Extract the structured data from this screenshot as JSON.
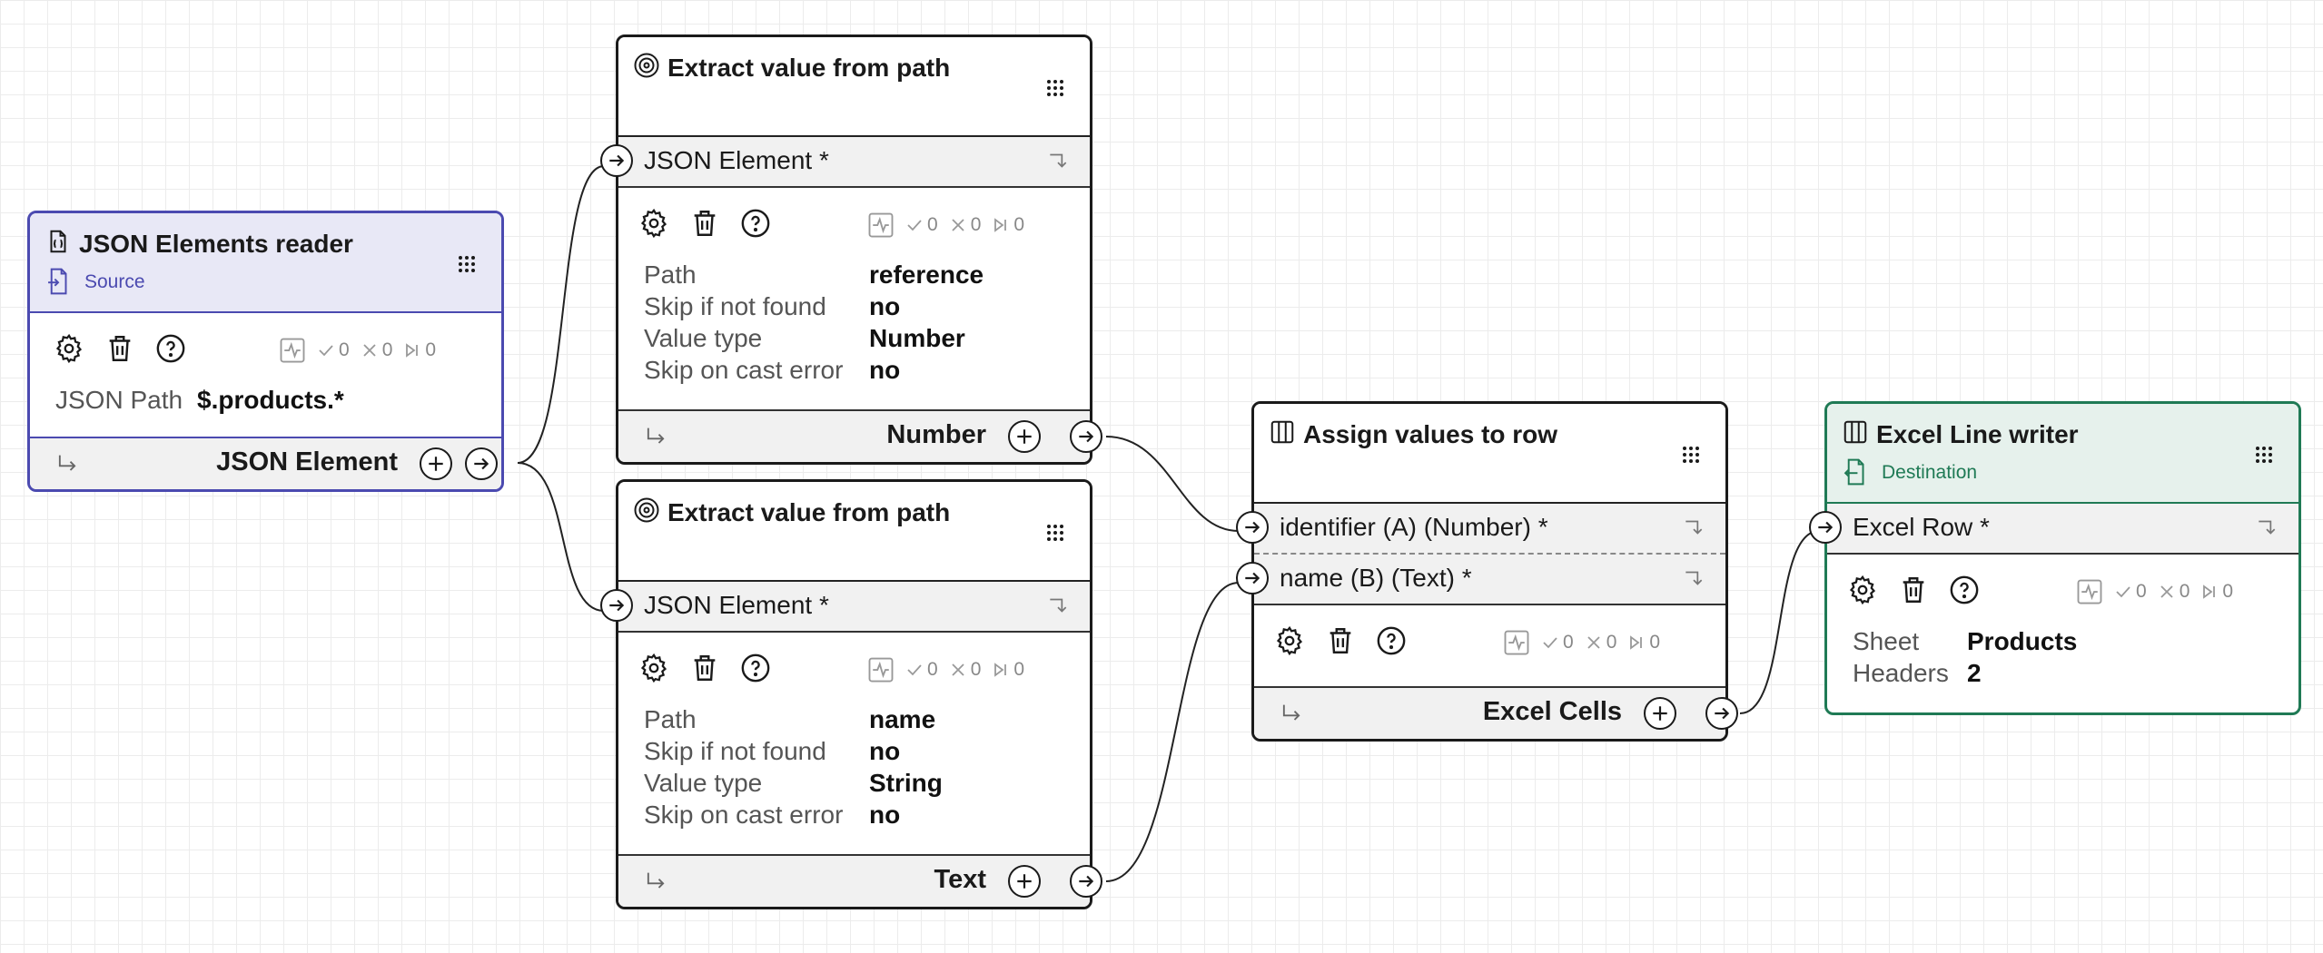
{
  "nodes": {
    "reader": {
      "title": "JSON Elements reader",
      "badge": "Source",
      "params": [
        {
          "key": "JSON Path",
          "value": "$.products.*"
        }
      ],
      "output": "JSON Element",
      "stats": {
        "ok": "0",
        "fail": "0",
        "skip": "0"
      }
    },
    "extract1": {
      "title": "Extract value from path",
      "input": "JSON Element *",
      "params": [
        {
          "key": "Path",
          "value": "reference"
        },
        {
          "key": "Skip if not found",
          "value": "no"
        },
        {
          "key": "Value type",
          "value": "Number"
        },
        {
          "key": "Skip on cast error",
          "value": "no"
        }
      ],
      "output": "Number",
      "stats": {
        "ok": "0",
        "fail": "0",
        "skip": "0"
      }
    },
    "extract2": {
      "title": "Extract value from path",
      "input": "JSON Element *",
      "params": [
        {
          "key": "Path",
          "value": "name"
        },
        {
          "key": "Skip if not found",
          "value": "no"
        },
        {
          "key": "Value type",
          "value": "String"
        },
        {
          "key": "Skip on cast error",
          "value": "no"
        }
      ],
      "output": "Text",
      "stats": {
        "ok": "0",
        "fail": "0",
        "skip": "0"
      }
    },
    "assign": {
      "title": "Assign values to row",
      "inputs": [
        "identifier (A) (Number) *",
        "name (B) (Text) *"
      ],
      "output": "Excel Cells",
      "stats": {
        "ok": "0",
        "fail": "0",
        "skip": "0"
      }
    },
    "writer": {
      "title": "Excel Line writer",
      "badge": "Destination",
      "input": "Excel Row *",
      "params": [
        {
          "key": "Sheet",
          "value": "Products"
        },
        {
          "key": "Headers",
          "value": "2"
        }
      ],
      "stats": {
        "ok": "0",
        "fail": "0",
        "skip": "0"
      }
    }
  },
  "colors": {
    "source": "#4b4ab0",
    "destination": "#1f7a55",
    "border": "#1a1a1a"
  }
}
